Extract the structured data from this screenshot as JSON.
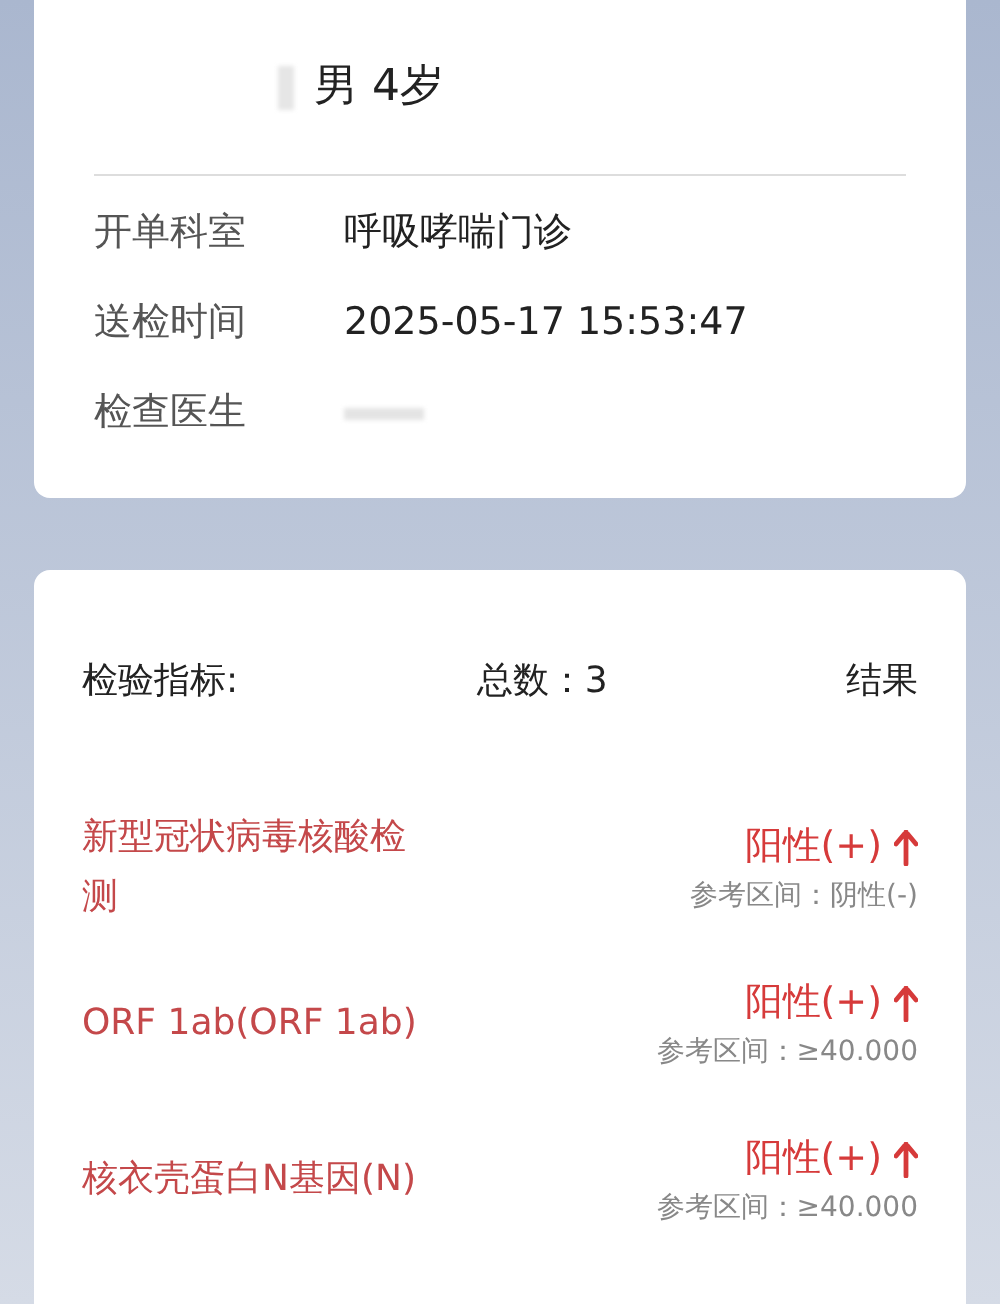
{
  "patient": {
    "sex_age": "男 4岁"
  },
  "info": [
    {
      "label": "开单科室",
      "value": "呼吸哮喘门诊"
    },
    {
      "label": "送检时间",
      "value": "2025-05-17 15:53:47"
    },
    {
      "label": "检查医生"
    }
  ],
  "results_header": {
    "column_1": "检验指标:",
    "count": "总数：3",
    "column_3": "结果"
  },
  "results": [
    {
      "name": "新型冠状病毒核酸检测",
      "result": "阳性(+)",
      "abnormal": true,
      "reference": "参考区间：阴性(-)"
    },
    {
      "name": "ORF 1ab(ORF 1ab)",
      "result": "阳性(+)",
      "abnormal": true,
      "reference": "参考区间：≥40.000"
    },
    {
      "name": "核衣壳蛋白N基因(N)",
      "result": "阳性(+)",
      "abnormal": true,
      "reference": "参考区间：≥40.000"
    }
  ]
}
